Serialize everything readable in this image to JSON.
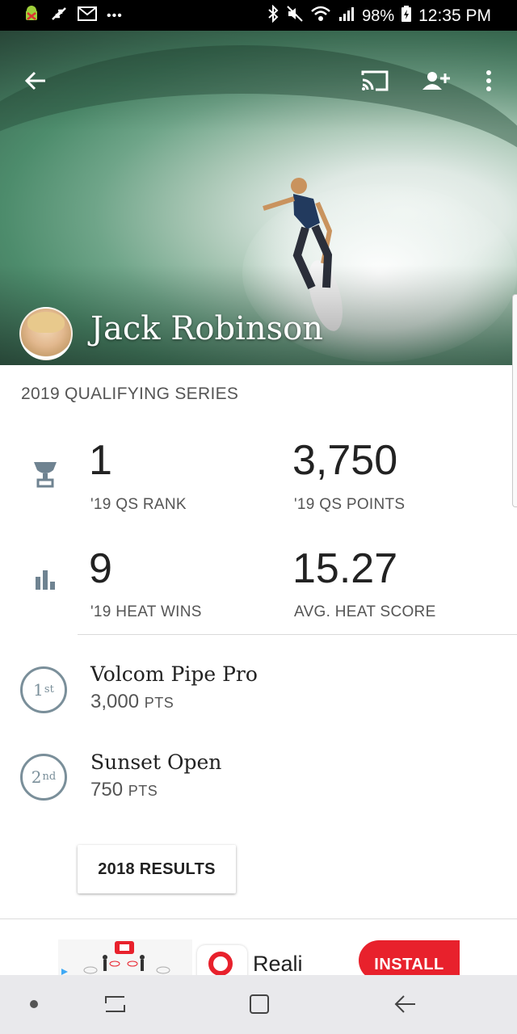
{
  "status_bar": {
    "battery": "98%",
    "time": "12:35 PM",
    "overflow": "•••"
  },
  "hero": {
    "athlete_name": "Jack Robinson"
  },
  "stats": {
    "section_title": "2019 QUALIFYING SERIES",
    "items": [
      {
        "value": "1",
        "label": "'19 QS RANK"
      },
      {
        "value": "3,750",
        "label": "'19 QS POINTS"
      },
      {
        "value": "9",
        "label": "'19 HEAT WINS"
      },
      {
        "value": "15.27",
        "label": "AVG. HEAT SCORE"
      }
    ]
  },
  "results": [
    {
      "place_num": "1",
      "place_suffix": "st",
      "event": "Volcom Pipe Pro",
      "points": "3,000",
      "unit": "PTS"
    },
    {
      "place_num": "2",
      "place_suffix": "nd",
      "event": "Sunset Open",
      "points": "750",
      "unit": "PTS"
    }
  ],
  "buttons": {
    "prev_results": "2018 RESULTS"
  },
  "ad": {
    "title": "Reali",
    "install": "INSTALL",
    "brand_color": "#e8212c"
  }
}
